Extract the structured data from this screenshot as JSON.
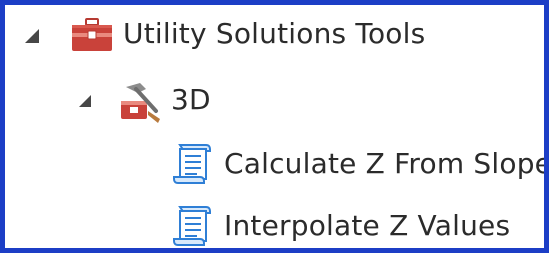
{
  "tree": {
    "items": [
      {
        "label": "Utility Solutions Tools",
        "icon": "toolbox-icon",
        "expanded": true
      },
      {
        "label": "3D",
        "icon": "toolset-icon",
        "expanded": true
      },
      {
        "label": "Calculate Z From Slope",
        "icon": "script-tool-icon"
      },
      {
        "label": "Interpolate Z Values",
        "icon": "script-tool-icon"
      }
    ]
  },
  "colors": {
    "frame_border": "#1c3ec6",
    "toolbox_red": "#c9423a",
    "script_blue": "#2f7fd6",
    "text": "#2b2b2b"
  }
}
